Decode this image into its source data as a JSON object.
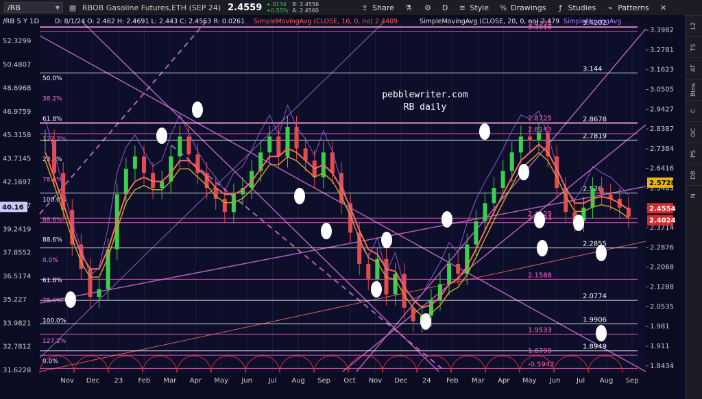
{
  "toolbar": {
    "symbol": "/RB",
    "description": "RBOB Gasoline Futures,ETH (SEP 24)",
    "last": "2.4559",
    "change": "+.0134",
    "change_pct": "+0.55%",
    "bid": "B: 2.4556",
    "ask": "A: 2.4560",
    "share": "Share",
    "period": "D",
    "style": "Style",
    "drawings": "Drawings",
    "studies": "Studies",
    "patterns": "Patterns"
  },
  "side_tabs": [
    "L2",
    "TS",
    "AT",
    "Btns",
    "C",
    "OC",
    "PS",
    "DB",
    "N"
  ],
  "chart_data": {
    "type": "line",
    "title": "/RB 5 Y 1D",
    "ohlc_text": "D: 8/1/24   O: 2.462   H: 2.4691   L: 2.443   C: 2.4563   R: 0.0261",
    "study1": "SimpleMovingAvg (CLOSE, 10, 0, no)",
    "study1_value": "2.4409",
    "study2": "SimpleMovingAvg (CLOSE, 20, 0, no)",
    "study2_value": "2.479",
    "study3": "SimpleMovingAvg",
    "watermark": "pebblewriter.com\nRB daily",
    "xticks": [
      "Nov",
      "Dec",
      "23",
      "Feb",
      "Mar",
      "Apr",
      "May",
      "Jun",
      "Jul",
      "Aug",
      "Sep",
      "Oct",
      "Nov",
      "Dec",
      "24",
      "Feb",
      "Mar",
      "Apr",
      "May",
      "Jun",
      "Jul",
      "Aug",
      "Sep"
    ],
    "left_ticks": [
      "52.3299",
      "50.4807",
      "48.6968",
      "46.9759",
      "45.3158",
      "43.7145",
      "42.1697",
      "40.6797",
      "39.2419",
      "37.8552",
      "36.5174",
      "35.227",
      "33.9821",
      "32.7812",
      "31.6228"
    ],
    "right_ticks": [
      "3.3982",
      "3.2781",
      "3.1623",
      "3.0505",
      "2.9427",
      "2.8387",
      "2.7384",
      "2.6416",
      "2.5483",
      "2.4582",
      "2.3714",
      "2.2876",
      "2.2068",
      "2.1288",
      "2.0535",
      "1.981",
      "1.911",
      "1.8434"
    ],
    "ylim": [
      1.82,
      3.45
    ],
    "price_badges": [
      {
        "text": "2.5728",
        "bg": "#e5b50e",
        "fg": "#000"
      },
      {
        "text": "2.4554",
        "bg": "#d22c2c",
        "fg": "#fff"
      },
      {
        "text": "2.4024",
        "bg": "#d22c2c",
        "fg": "#fff"
      },
      {
        "text": "40.16",
        "bg": "#c9c9ff",
        "fg": "#000"
      }
    ],
    "fib_left": [
      "50.0%",
      "38.2%",
      "61.8%",
      "127.2%",
      "23.6%",
      "78.6%",
      "100.0%",
      "88.6%",
      "88.6%",
      "0.0%",
      "61.8%",
      "78.6%",
      "100.0%",
      "127.2%",
      "0.0%"
    ],
    "levels": [
      {
        "label": "3.144",
        "y": 3.144,
        "color": "#ffffff"
      },
      {
        "label": "2.8678",
        "y": 2.8678,
        "color": "#ffffff"
      },
      {
        "label": "2.8725",
        "y": 2.8725,
        "color": "#ff5fb0"
      },
      {
        "label": "2.8143",
        "y": 2.8143,
        "color": "#ff5fd0"
      },
      {
        "label": "2.7819",
        "y": 2.7819,
        "color": "#ffffff"
      },
      {
        "label": "2.526",
        "y": 2.526,
        "color": "#ffffff"
      },
      {
        "label": "2.4129",
        "y": 2.4129,
        "color": "#ff5fb0"
      },
      {
        "label": "2.3934",
        "y": 2.3934,
        "color": "#ff5fd0"
      },
      {
        "label": "2.2855",
        "y": 2.2855,
        "color": "#ffffff"
      },
      {
        "label": "2.1588",
        "y": 2.1588,
        "color": "#ff5fd0"
      },
      {
        "label": "2.0774",
        "y": 2.0774,
        "color": "#ffffff"
      },
      {
        "label": "1.9906",
        "y": 1.9906,
        "color": "#ffffff"
      },
      {
        "label": "1.9533",
        "y": 1.9533,
        "color": "#ff5fb0"
      },
      {
        "label": "1.8949",
        "y": 1.8949,
        "color": "#ffffff"
      },
      {
        "label": "1.8799",
        "y": 1.8799,
        "color": "#ff5fd0"
      },
      {
        "label": "3.4202",
        "y": 3.4202,
        "color": "#ffffff"
      },
      {
        "label": "3.4134",
        "y": 3.4134,
        "color": "#ff5fb0"
      },
      {
        "label": "3.3916",
        "y": 3.3916,
        "color": "#ff5fd0"
      },
      {
        "label": "-0.5942",
        "y": 1.835,
        "color": "#ff5fb0"
      }
    ],
    "close_series": [
      2.78,
      2.62,
      2.45,
      2.3,
      2.2,
      2.09,
      2.12,
      2.28,
      2.52,
      2.64,
      2.7,
      2.62,
      2.55,
      2.58,
      2.7,
      2.8,
      2.71,
      2.62,
      2.55,
      2.5,
      2.44,
      2.52,
      2.55,
      2.63,
      2.72,
      2.8,
      2.7,
      2.85,
      2.74,
      2.68,
      2.6,
      2.72,
      2.62,
      2.48,
      2.35,
      2.22,
      2.16,
      2.24,
      2.1,
      2.18,
      2.05,
      2.0,
      2.02,
      2.08,
      2.14,
      2.22,
      2.18,
      2.3,
      2.4,
      2.48,
      2.55,
      2.63,
      2.72,
      2.8,
      2.78,
      2.82,
      2.7,
      2.55,
      2.44,
      2.4,
      2.46,
      2.55,
      2.52,
      2.5,
      2.46,
      2.42
    ],
    "sma_close_series": [
      2.72,
      2.6,
      2.48,
      2.36,
      2.26,
      2.2,
      2.2,
      2.28,
      2.4,
      2.52,
      2.58,
      2.6,
      2.58,
      2.58,
      2.62,
      2.68,
      2.68,
      2.64,
      2.6,
      2.55,
      2.52,
      2.52,
      2.54,
      2.58,
      2.64,
      2.7,
      2.7,
      2.74,
      2.72,
      2.68,
      2.64,
      2.66,
      2.62,
      2.55,
      2.46,
      2.36,
      2.28,
      2.26,
      2.2,
      2.19,
      2.13,
      2.08,
      2.05,
      2.06,
      2.09,
      2.14,
      2.16,
      2.21,
      2.28,
      2.36,
      2.44,
      2.52,
      2.6,
      2.68,
      2.72,
      2.76,
      2.72,
      2.64,
      2.55,
      2.48,
      2.48,
      2.5,
      2.51,
      2.5,
      2.48,
      2.45
    ]
  }
}
